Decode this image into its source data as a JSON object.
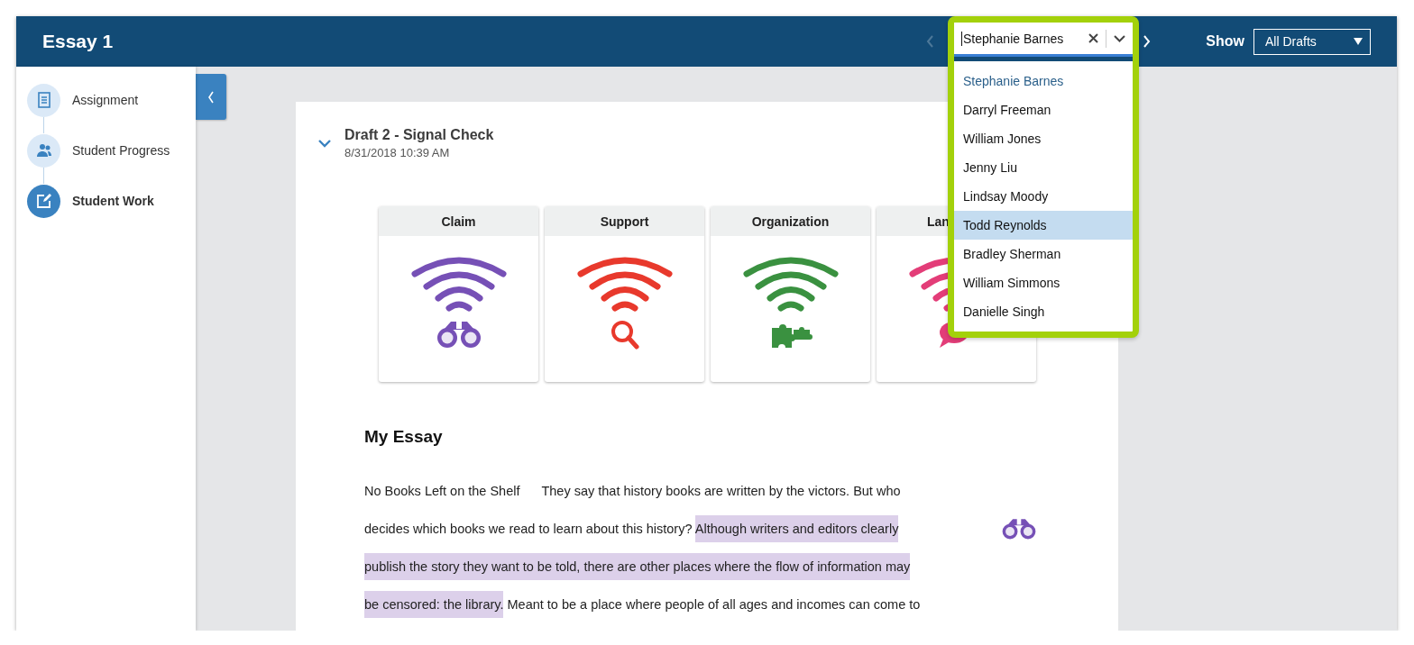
{
  "header": {
    "title": "Essay 1",
    "show_label": "Show",
    "drafts_select": {
      "value": "All Drafts"
    },
    "prev_disabled": true
  },
  "sidebar": {
    "items": [
      {
        "label": "Assignment",
        "selected": false
      },
      {
        "label": "Student Progress",
        "selected": false
      },
      {
        "label": "Student Work",
        "selected": true
      }
    ]
  },
  "draft": {
    "title": "Draft 2 - Signal Check",
    "date": "8/31/2018 10:39 AM",
    "expanded": true
  },
  "signals": [
    {
      "label": "Claim",
      "color": "#7650b6",
      "covered": false
    },
    {
      "label": "Support",
      "color": "#e8392c",
      "covered": false
    },
    {
      "label": "Organization",
      "color": "#3a9140",
      "covered": false
    },
    {
      "label": "Lan",
      "color": "#e33d78",
      "covered": true
    }
  ],
  "essay": {
    "heading": "My Essay",
    "lines": [
      [
        {
          "text": "No Books Left on the Shelf      They say that history books are written by the victors. But who",
          "highlighted": false
        }
      ],
      [
        {
          "text": "decides which books we read to learn about this history? ",
          "highlighted": false
        },
        {
          "text": "Although writers and editors clearly",
          "highlighted": true
        }
      ],
      [
        {
          "text": "publish the story they want to be told, there are other places where the flow of information may",
          "highlighted": true
        }
      ],
      [
        {
          "text": "be censored: the library.",
          "highlighted": true
        },
        {
          "text": " Meant to be a place where people of all ages and incomes can come to",
          "highlighted": false
        }
      ]
    ]
  },
  "student_picker": {
    "value": "Stephanie Barnes",
    "options": [
      {
        "label": "Stephanie Barnes",
        "selected": true,
        "highlighted": false
      },
      {
        "label": "Darryl Freeman",
        "selected": false,
        "highlighted": false
      },
      {
        "label": "William Jones",
        "selected": false,
        "highlighted": false
      },
      {
        "label": "Jenny Liu",
        "selected": false,
        "highlighted": false
      },
      {
        "label": "Lindsay Moody",
        "selected": false,
        "highlighted": false
      },
      {
        "label": "Todd Reynolds",
        "selected": false,
        "highlighted": true
      },
      {
        "label": "Bradley Sherman",
        "selected": false,
        "highlighted": false
      },
      {
        "label": "William Simmons",
        "selected": false,
        "highlighted": false
      },
      {
        "label": "Danielle Singh",
        "selected": false,
        "highlighted": false
      }
    ]
  }
}
